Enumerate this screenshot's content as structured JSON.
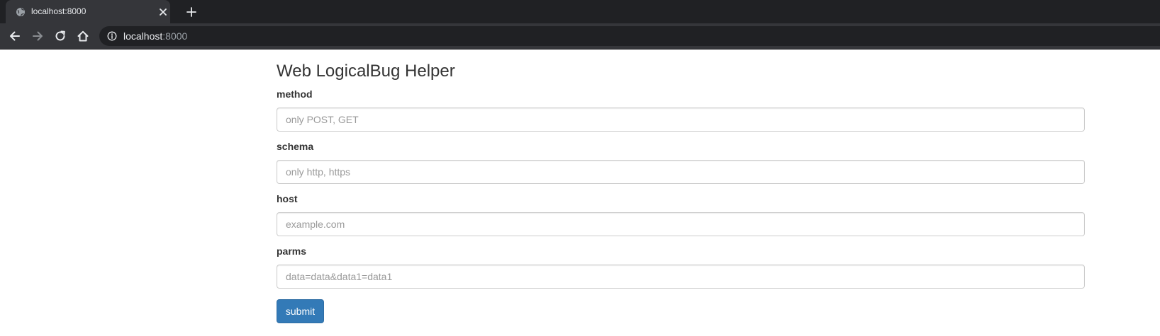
{
  "browser": {
    "tab_title": "localhost:8000",
    "url_host": "localhost",
    "url_port": ":8000",
    "icons": {
      "favicon": "globe-icon",
      "close": "close-icon",
      "new_tab": "plus-icon",
      "back": "arrow-left-icon",
      "forward": "arrow-right-icon",
      "reload": "reload-icon",
      "home": "home-icon",
      "info": "info-icon"
    },
    "colors": {
      "chrome_dark": "#202124",
      "chrome_tab": "#35363a",
      "chrome_text": "#e8eaed"
    }
  },
  "page": {
    "title": "Web LogicalBug Helper",
    "fields": [
      {
        "label": "method",
        "placeholder": "only POST, GET",
        "value": ""
      },
      {
        "label": "schema",
        "placeholder": "only http, https",
        "value": ""
      },
      {
        "label": "host",
        "placeholder": "example.com",
        "value": ""
      },
      {
        "label": "parms",
        "placeholder": "data=data&data1=data1",
        "value": ""
      }
    ],
    "submit_label": "submit",
    "colors": {
      "primary": "#337ab7",
      "text": "#333333",
      "border": "#cccccc",
      "placeholder": "#999999"
    }
  }
}
